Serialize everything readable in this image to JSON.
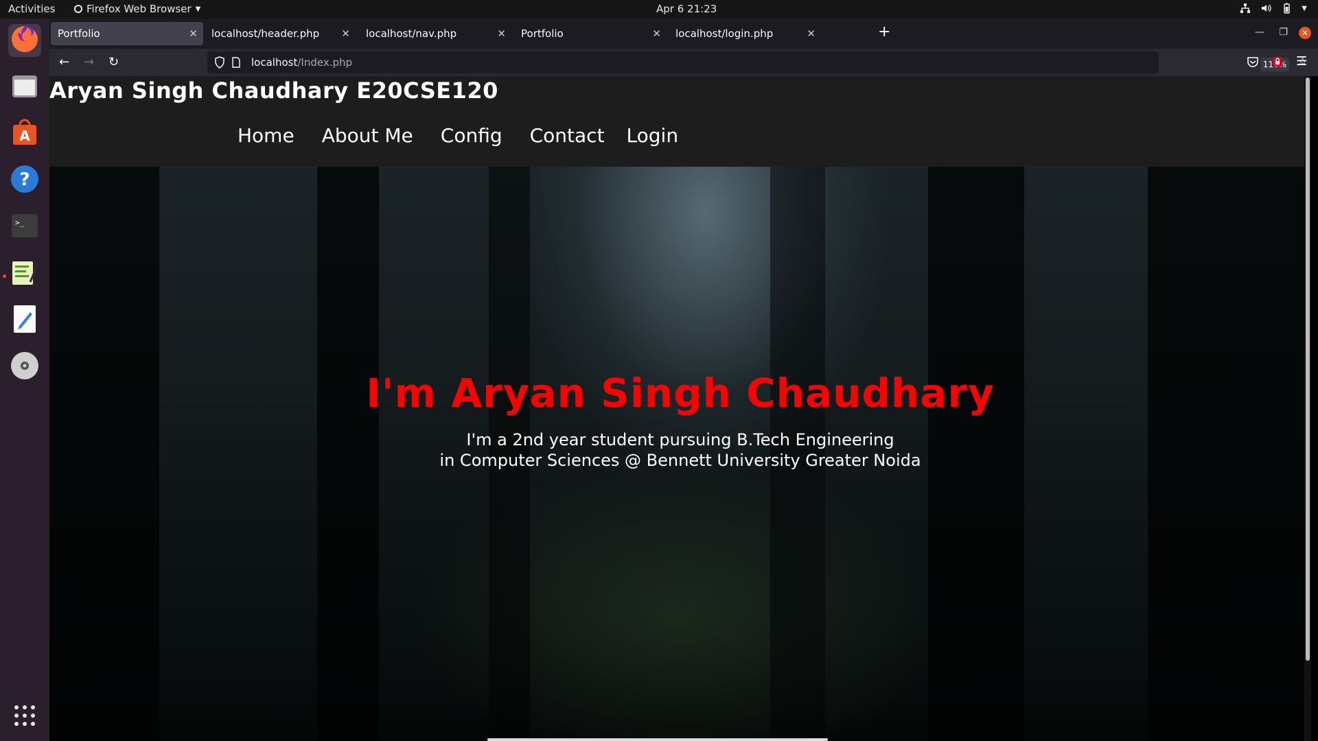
{
  "topbar": {
    "activities": "Activities",
    "app_name": "Firefox Web Browser",
    "clock": "Apr 6  21:23"
  },
  "dock": {
    "items": [
      "firefox",
      "files",
      "ubuntu-software",
      "help",
      "terminal",
      "gedit-text-editor",
      "libreoffice-writer",
      "disc"
    ]
  },
  "tabs": [
    {
      "label": "Portfolio",
      "active": true
    },
    {
      "label": "localhost/header.php",
      "active": false
    },
    {
      "label": "localhost/nav.php",
      "active": false
    },
    {
      "label": "Portfolio",
      "active": false
    },
    {
      "label": "localhost/login.php",
      "active": false
    }
  ],
  "urlbar": {
    "host": "localhost",
    "path": "/Index.php",
    "zoom": "110%"
  },
  "site": {
    "title": "Aryan Singh Chaudhary E20CSE120",
    "nav": [
      "Home",
      "About Me",
      "Config",
      "Contact",
      "Login"
    ],
    "hero_title": "I'm Aryan Singh Chaudhary",
    "hero_line1": "I'm a 2nd year student pursuing B.Tech Engineering",
    "hero_line2": "in Computer Sciences @ Bennett University Greater Noida"
  },
  "colors": {
    "hero_title": "#ff0000",
    "header_bg": "#1d1d1d",
    "dock_bg": "#2c1f2d",
    "accent": "#e95420"
  }
}
